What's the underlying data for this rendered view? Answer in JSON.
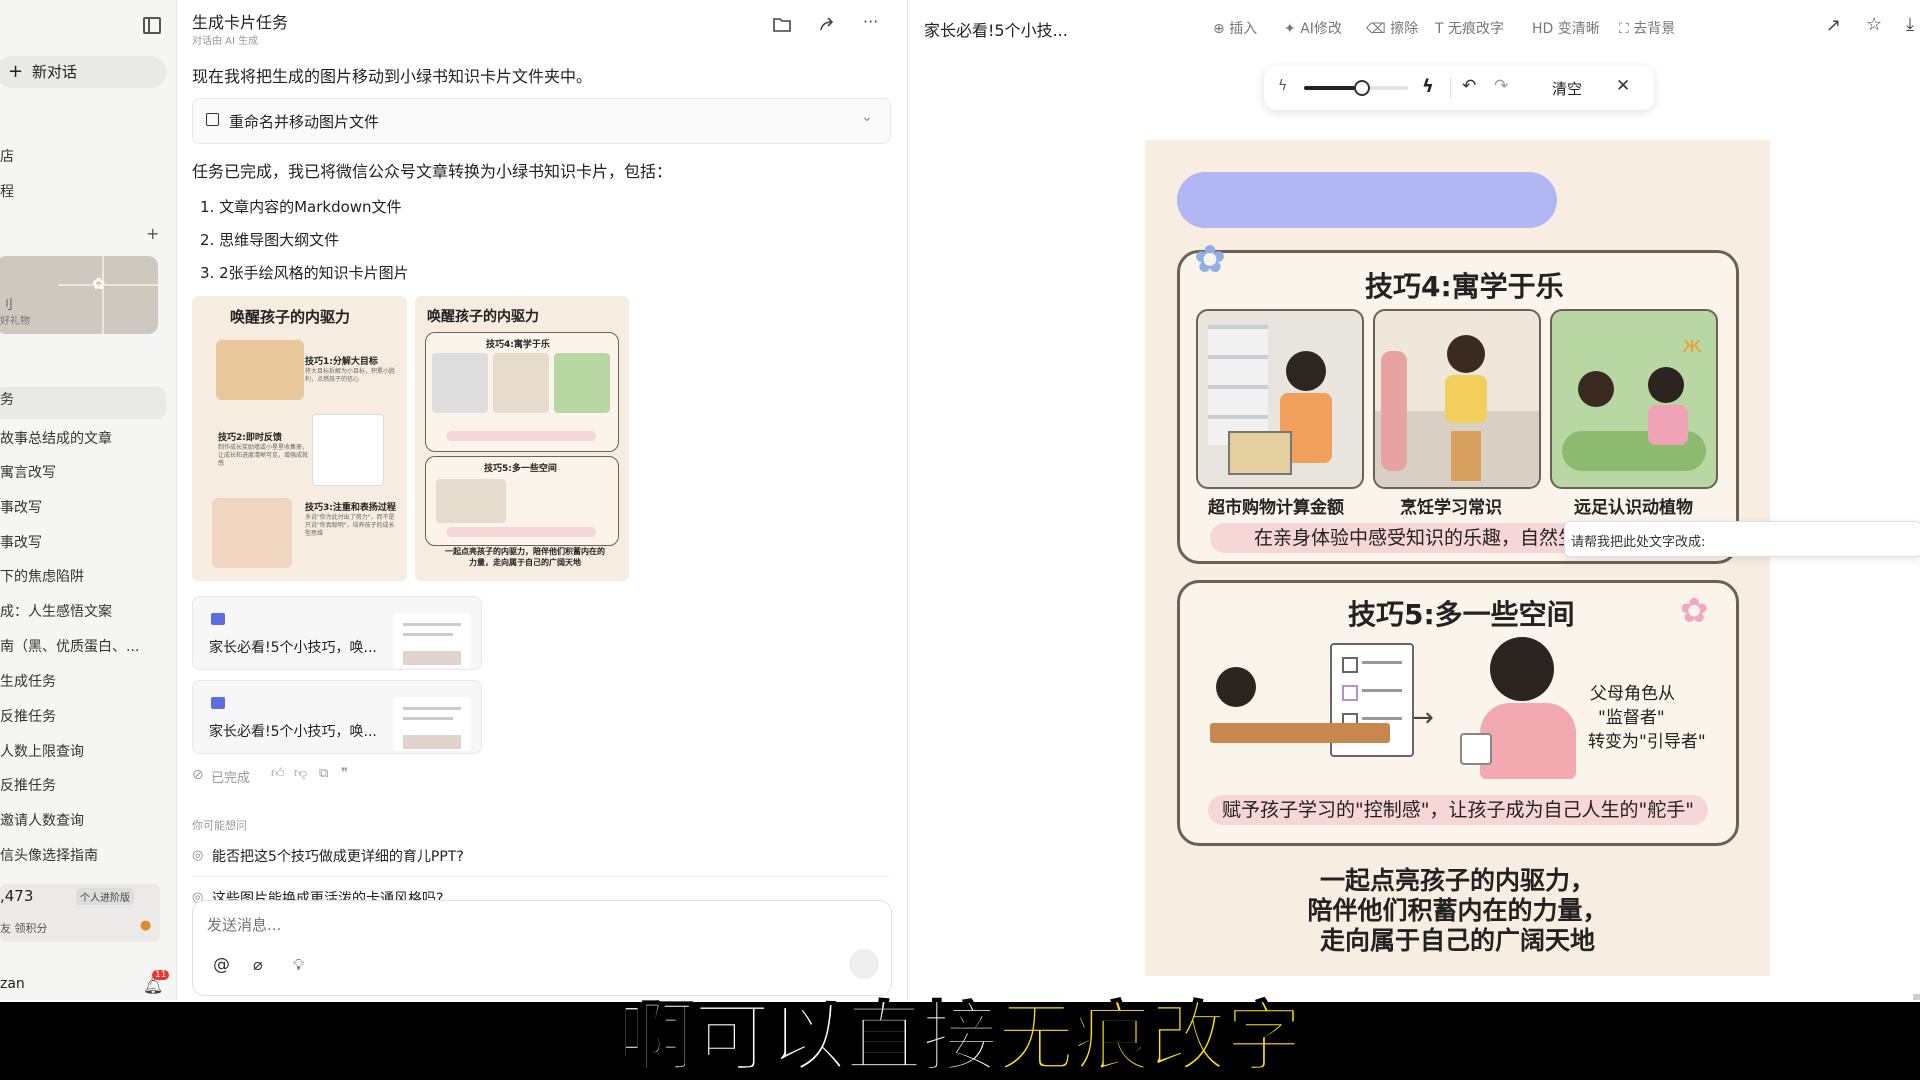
{
  "sidebar": {
    "new_chat": "新对话",
    "items_top": [
      "店",
      "程"
    ],
    "promo": {
      "line1": "刂",
      "line2": "好礼物"
    },
    "history": [
      "务",
      "故事总结成的文章",
      "寓言改写",
      "事改写",
      "事改写",
      "下的焦虑陷阱",
      "成：人生感悟文案",
      "南（黑、优质蛋白、...",
      "生成任务",
      "反推任务",
      "人数上限查询",
      "反推任务",
      "邀请人数查询",
      "信头像选择指南"
    ],
    "credits": {
      "value": ",473",
      "plan": "个人进阶版",
      "link": "友 领积分"
    },
    "user": "zan",
    "notif_count": "11"
  },
  "chat": {
    "title": "生成卡片任务",
    "subtitle": "对话由 AI 生成",
    "msg1": "现在我将把生成的图片移动到小绿书知识卡片文件夹中。",
    "tool_call": "重命名并移动图片文件",
    "msg2": "任务已完成，我已将微信公众号文章转换为小绿书知识卡片，包括：",
    "list": [
      "1. 文章内容的Markdown文件",
      "2. 思维导图大纲文件",
      "3. 2张手绘风格的知识卡片图片"
    ],
    "thumb1": {
      "title": "唤醒孩子的内驱力",
      "t1": "技巧1:分解大目标",
      "t1_sub": "将大目标拆解为小目标，积累小胜利，点燃孩子的信心",
      "t2": "技巧2:即时反馈",
      "t2_sub": "制作成长奖励墙或小星星收集册，让成长和进度清晰可见，增强成就感",
      "t3": "技巧3:注重和表扬过程",
      "t3_sub": "多说\"你为此付出了努力\"，而不是只说\"你真聪明\"，培养孩子的成长型思维"
    },
    "thumb2": {
      "title": "唤醒孩子的内驱力",
      "t4": "技巧4:寓学于乐",
      "t5": "技巧5:多一些空间",
      "foot": "一起点亮孩子的内驱力，陪伴他们积蓄内在的力量，走向属于自己的广阔天地"
    },
    "file_cards": [
      "家长必看!5个小技巧，唤...",
      "家长必看!5个小技巧，唤..."
    ],
    "status": "已完成",
    "suggest_label": "你可能想问",
    "suggestions": [
      "能否把这5个技巧做成更详细的育儿PPT?",
      "这些图片能换成更活泼的卡通风格吗?"
    ],
    "input_placeholder": "发送消息..."
  },
  "editor": {
    "doc_title": "家长必看!5个小技...",
    "tools": [
      "插入",
      "AI修改",
      "擦除",
      "无痕改字",
      "HD 变清晰",
      "去背景"
    ],
    "brush_toolbar": {
      "clear": "清空",
      "slider_value": 0.55
    },
    "context_prompt": "请帮我把此处文字改成:"
  },
  "poster": {
    "tip4_title": "技巧4:寓学于乐",
    "tip4_captions": [
      "超市购物计算金额",
      "烹饪学习常识",
      "远足认识动植物"
    ],
    "tip4_band": "在亲身体验中感受知识的乐趣，自然生",
    "tip5_title": "技巧5:多一些空间",
    "tip5_role": [
      "父母角色从",
      "\"监督者\"",
      "转变为\"引导者\""
    ],
    "tip5_band": "赋予孩子学习的\"控制感\"，让孩子成为自己人生的\"舵手\"",
    "footer": [
      "一起点亮孩子的内驱力，",
      "陪伴他们积蓄内在的力量，",
      "走向属于自己的广阔天地"
    ]
  },
  "subtitle": {
    "white": "啊可以直接",
    "yellow": "无痕改字"
  },
  "colors": {
    "accent_yellow": "#ffe600",
    "mask_purple": "#a9b0f7",
    "band_pink": "#f6d6d6"
  }
}
